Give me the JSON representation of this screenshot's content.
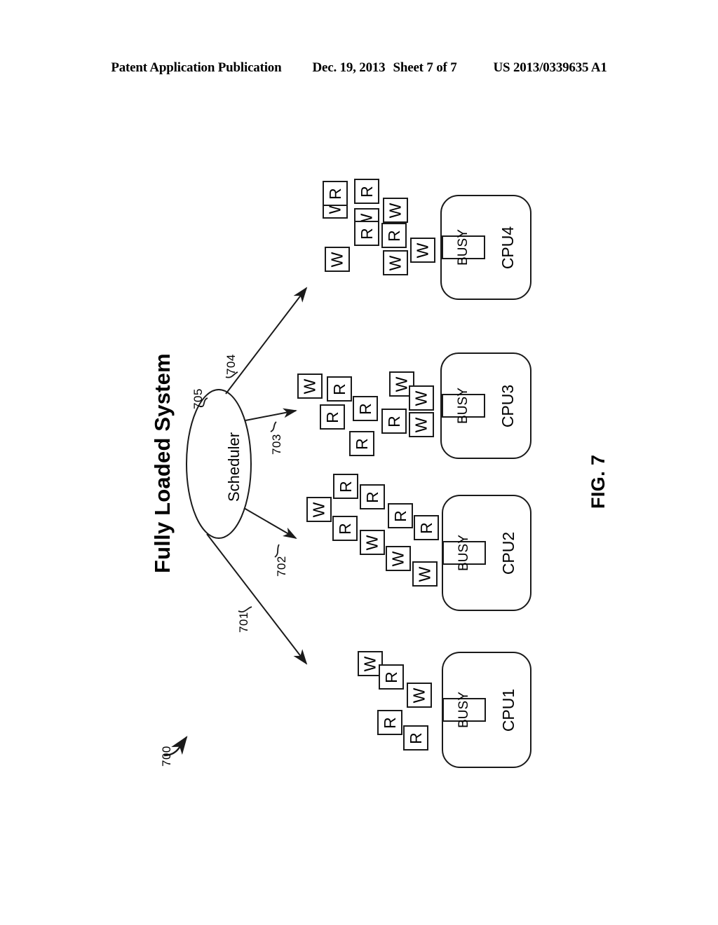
{
  "header": {
    "publication": "Patent Application Publication",
    "date": "Dec. 19, 2013",
    "sheet": "Sheet 7 of 7",
    "patent_number": "US 2013/0339635 A1"
  },
  "figure": {
    "title": "Fully Loaded System",
    "figure_label": "FIG. 7",
    "diagram_ref": "700",
    "scheduler": {
      "label": "Scheduler",
      "ref": "705"
    },
    "arrows": [
      {
        "ref": "701",
        "target": "CPU1"
      },
      {
        "ref": "702",
        "target": "CPU2"
      },
      {
        "ref": "703",
        "target": "CPU3"
      },
      {
        "ref": "704",
        "target": "CPU4"
      }
    ],
    "cpus": [
      {
        "name": "CPU1",
        "status": "BUSY"
      },
      {
        "name": "CPU2",
        "status": "BUSY"
      },
      {
        "name": "CPU3",
        "status": "BUSY"
      },
      {
        "name": "CPU4",
        "status": "BUSY"
      }
    ],
    "queues": {
      "cpu1": [
        "W",
        "R",
        "W",
        "R",
        "R"
      ],
      "cpu2": [
        "W",
        "R",
        "R",
        "R",
        "R",
        "R",
        "W",
        "W",
        "W"
      ],
      "cpu3": [
        "W",
        "R",
        "R",
        "R",
        "R",
        "R",
        "W",
        "W",
        "W"
      ],
      "cpu4": [
        "W",
        "R",
        "R",
        "W",
        "R",
        "W",
        "W",
        "R",
        "W",
        "W"
      ]
    },
    "task_legend": {
      "read": "R",
      "write": "W"
    }
  }
}
